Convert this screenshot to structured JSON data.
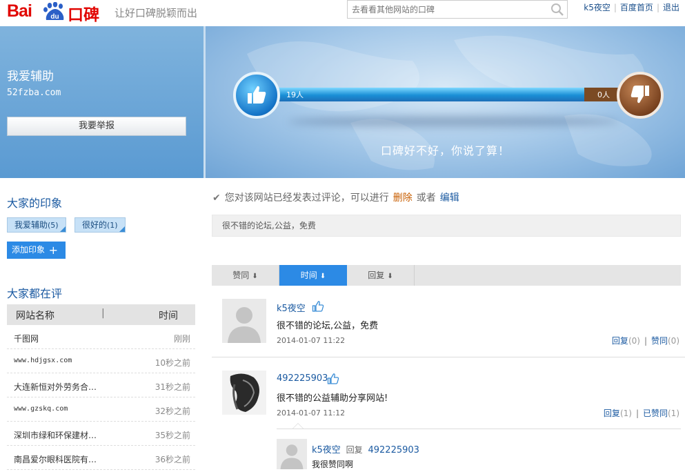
{
  "header": {
    "logo_bai": "Bai",
    "logo_du": "du",
    "logo_kb": "口碑",
    "slogan": "让好口碑脱颖而出",
    "search_placeholder": "去看看其他网站的口碑",
    "user": "k5夜空",
    "home_link": "百度首页",
    "logout_link": "退出"
  },
  "site": {
    "name": "我爱辅助",
    "url": "52fzba.com",
    "report_button": "我要举报"
  },
  "votes": {
    "up_count": "19人",
    "down_count": "0人",
    "up_fraction": 0.85,
    "tagline": "口碑好不好，你说了算！"
  },
  "impressions": {
    "title": "大家的印象",
    "tags": [
      {
        "label": "我爱辅助",
        "count": "(5)"
      },
      {
        "label": "很好的",
        "count": "(1)"
      }
    ],
    "add_button": "添加印象",
    "add_symbol": "+"
  },
  "ranking": {
    "title": "大家都在评",
    "col_site": "网站名称",
    "col_divider": "|",
    "col_time": "时间",
    "rows": [
      {
        "name": "千图网",
        "time": "刚刚"
      },
      {
        "name": "www.hdjgsx.com",
        "time": "10秒之前"
      },
      {
        "name": "大连新恒对外劳务合…",
        "time": "31秒之前"
      },
      {
        "name": "www.gzskq.com",
        "time": "32秒之前"
      },
      {
        "name": "深圳市绿和环保建材…",
        "time": "35秒之前"
      },
      {
        "name": "南昌爱尔眼科医院有…",
        "time": "36秒之前"
      }
    ]
  },
  "notice": {
    "check": "✔",
    "text": "您对该网站已经发表过评论，可以进行",
    "delete": "删除",
    "or": "或者",
    "edit": "编辑"
  },
  "my_comment": "很不错的论坛,公益，免费",
  "sort_tabs": [
    {
      "label": "赞同",
      "arrow": "⬇"
    },
    {
      "label": "时间",
      "arrow": "⬇"
    },
    {
      "label": "回复",
      "arrow": "⬇"
    }
  ],
  "comments": [
    {
      "user": "k5夜空",
      "text": "很不错的论坛,公益，免费",
      "time": "2014-01-07 11:22",
      "reply_label": "回复",
      "reply_count": "(0)",
      "sep": "|",
      "like_label": "赞同",
      "like_count": "(0)"
    },
    {
      "user": "492225903",
      "text": "很不错的公益辅助分享网站!",
      "time": "2014-01-07 11:12",
      "reply_label": "回复",
      "reply_count": "(1)",
      "sep": "|",
      "like_label": "已赞同",
      "like_count": "(1)"
    }
  ],
  "reply": {
    "user": "k5夜空",
    "verb": "回复",
    "target": "492225903",
    "text": "我很赞同啊"
  }
}
